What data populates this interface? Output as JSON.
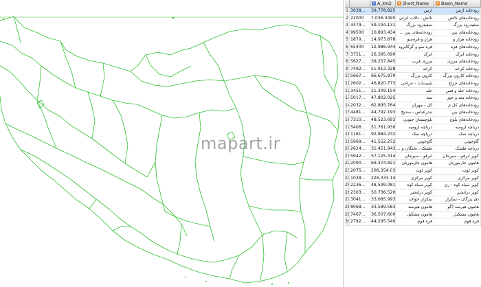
{
  "watermark": "mapart.ir",
  "colors": {
    "boundary": "#2fbf2f",
    "frame": "#c8c8c8",
    "selection": "#cfe4fb"
  },
  "table": {
    "columns": [
      {
        "label": "",
        "icon": ""
      },
      {
        "label": "",
        "icon": ""
      },
      {
        "label": "A_km2",
        "icon": "number-field-icon"
      },
      {
        "label": "Short_Name",
        "icon": "string-field-icon"
      },
      {
        "label": "Basin_Name",
        "icon": "string-field-icon"
      }
    ],
    "rows": [
      [
        "1",
        "3638...",
        "39,778.8252731...",
        "ارس",
        "رودخانه ارس"
      ],
      [
        "2",
        "22000",
        "7,036.34951789...",
        "تالش - تالاب انزلی",
        "رودخانه‌های تالش"
      ],
      [
        "3",
        "3479...",
        "59,194.1312413...",
        "سفیدرود بزرگ",
        "سفیدرود بزرگ"
      ],
      [
        "4",
        "99500",
        "10,893.4340205...",
        "رودخانه‌های بین ...",
        "رودخانه‌های بین"
      ],
      [
        "5",
        "1879...",
        "14,973.8786335...",
        "هراز و قره‌سو",
        "رودخانه هراز و"
      ],
      [
        "6",
        "65400",
        "12,986.9444372...",
        "قره سو و گرگانرود",
        "رودخانه‌های قره"
      ],
      [
        "7",
        "3751...",
        "26,395.6909587...",
        "اترک",
        "رودخانه اترک"
      ],
      [
        "8",
        "5627...",
        "39,257.8451121...",
        "مرزی غرب",
        "رودخانه‌های مرزی"
      ],
      [
        "9",
        "7492...",
        "51,912.3281129...",
        "کرخه",
        "رودخانه کرخه"
      ],
      [
        "10",
        "5667...",
        "66,675.8704889...",
        "کارون بزرگ",
        "رودخانه کارون بزرگ"
      ],
      [
        "11",
        "2602...",
        "46,820.7732504...",
        "شیبدیات - جراحی",
        "رودخانه‌های جراح"
      ],
      [
        "12",
        "3451...",
        "21,309.1546074...",
        "حله",
        "رودخانه حله و فس"
      ],
      [
        "13",
        "5017...",
        "47,802.0250832...",
        "مند",
        "رودخانه مند و حوز"
      ],
      [
        "14",
        "2032...",
        "62,895.7646494...",
        "کل - مهران",
        "رودخانه‌های کل م"
      ],
      [
        "15",
        "4481...",
        "44,792.1930920...",
        "بندرعباس - سدیج",
        "رودخانه‌های بین"
      ],
      [
        "16",
        "7310...",
        "48,523.6937879...",
        "بلوچستان جنوبی",
        "رودخانه‌های بلوچ"
      ],
      [
        "17",
        "5406...",
        "51,761.9308284...",
        "دریاچه ارومیه",
        "دریاچه ارومیه"
      ],
      [
        "18",
        "1161...",
        "92,884.2323029...",
        "دریاچه نمک",
        "دریاچه نمک"
      ],
      [
        "19",
        "5969...",
        "41,552.2722402...",
        "گاوخونی",
        "گاوخونی"
      ],
      [
        "20",
        "2624...",
        "31,451.9433995...",
        "طشک ، بختگان و ...",
        "دریاچه طشک"
      ],
      [
        "21",
        "5942...",
        "57,125.3147724...",
        "ابرقو - سیرجان",
        "کویر ابرقو - سیرجان"
      ],
      [
        "22",
        "2090...",
        "69,374.8219900...",
        "هامون جازموریان",
        "هامون جازموریان"
      ],
      [
        "23",
        "2075...",
        "206,354.033935...",
        "کویر لوت",
        "کویر لوت"
      ],
      [
        "24",
        "1038...",
        "226,333.149131...",
        "کویر مرکزی",
        "کویر مرکزی"
      ],
      [
        "25",
        "2236...",
        "48,599.0816614...",
        "کویر سیاه کوه",
        "کویر سیاه کوه - ری"
      ],
      [
        "26",
        "2303...",
        "50,736.5208753...",
        "کویر درانجیر",
        "کویر درانجیر"
      ],
      [
        "27",
        "3041...",
        "33,085.9933936...",
        "نمکزار خواف",
        "دق پترگان - نمکزار"
      ],
      [
        "28",
        "8068...",
        "33,589.5832473...",
        "هامون هیرمند",
        "هامون هیرمند (گو"
      ],
      [
        "29",
        "7467...",
        "36,507.6009452...",
        "هامون مشکیل",
        "هامون مشکیل"
      ],
      [
        "30",
        "2792...",
        "44,295.5408563...",
        "قره قوم",
        "قره قوم"
      ]
    ]
  }
}
